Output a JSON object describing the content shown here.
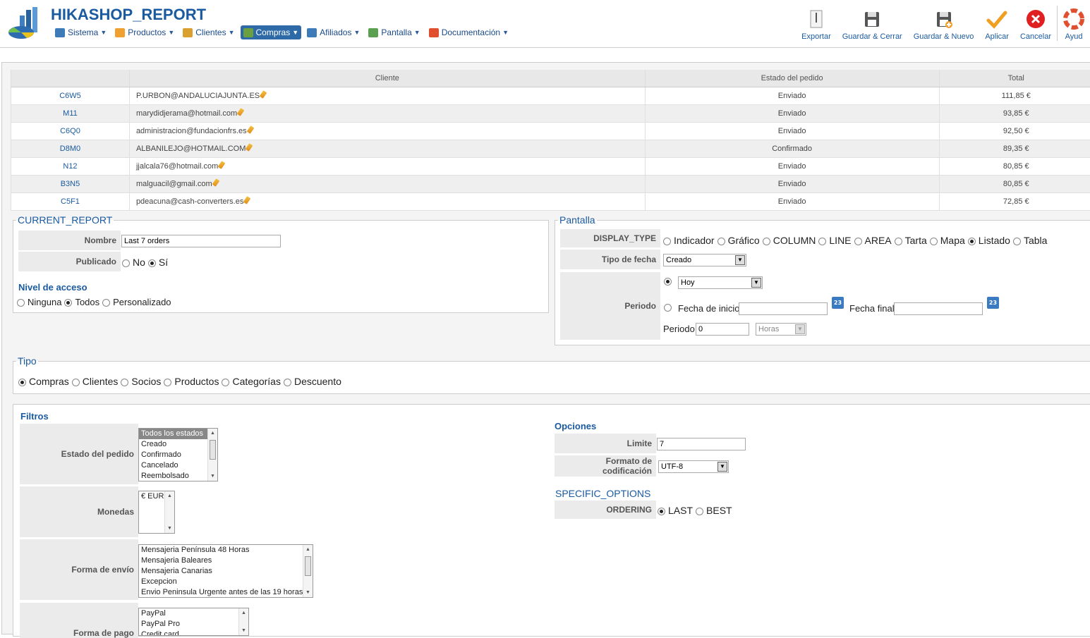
{
  "app": {
    "title": "HIKASHOP_REPORT"
  },
  "menu": [
    {
      "label": "Sistema",
      "icon": "tools-icon",
      "color": "#3c7ab8"
    },
    {
      "label": "Productos",
      "icon": "products-icon",
      "color": "#f0a030"
    },
    {
      "label": "Clientes",
      "icon": "users-icon",
      "color": "#d9a030"
    },
    {
      "label": "Compras",
      "icon": "orders-icon",
      "color": "#6aa040",
      "active": true
    },
    {
      "label": "Afiliados",
      "icon": "affiliates-icon",
      "color": "#3c7ab8"
    },
    {
      "label": "Pantalla",
      "icon": "display-icon",
      "color": "#5aa050"
    },
    {
      "label": "Documentación",
      "icon": "help-icon",
      "color": "#e05030"
    }
  ],
  "toolbar": {
    "export_label": "Exportar",
    "save_close_label": "Guardar & Cerrar",
    "save_new_label": "Guardar & Nuevo",
    "apply_label": "Aplicar",
    "cancel_label": "Cancelar",
    "help_label": "Ayud"
  },
  "orders": {
    "columns": [
      "",
      "Cliente",
      "Estado del pedido",
      "Total"
    ],
    "rows": [
      {
        "number": "C6W5",
        "client": "P.URBON@ANDALUCIAJUNTA.ES",
        "status": "Enviado",
        "total": "111,85 €"
      },
      {
        "number": "M11",
        "client": "marydidjerama@hotmail.com",
        "status": "Enviado",
        "total": "93,85 €"
      },
      {
        "number": "C6Q0",
        "client": "administracion@fundacionfrs.es",
        "status": "Enviado",
        "total": "92,50 €"
      },
      {
        "number": "D8M0",
        "client": "ALBANILEJO@HOTMAIL.COM",
        "status": "Confirmado",
        "total": "89,35 €"
      },
      {
        "number": "N12",
        "client": "jjalcala76@hotmail.com",
        "status": "Enviado",
        "total": "80,85 €"
      },
      {
        "number": "B3N5",
        "client": "malguacil@gmail.com",
        "status": "Enviado",
        "total": "80,85 €"
      },
      {
        "number": "C5F1",
        "client": "pdeacuna@cash-converters.es",
        "status": "Enviado",
        "total": "72,85 €"
      }
    ]
  },
  "current_report": {
    "legend": "CURRENT_REPORT",
    "name_label": "Nombre",
    "name_value": "Last 7 orders",
    "published_label": "Publicado",
    "published_options": [
      "No",
      "Sí"
    ],
    "published_selected": "Sí",
    "access_title": "Nivel de acceso",
    "access_options": [
      "Ninguna",
      "Todos",
      "Personalizado"
    ],
    "access_selected": "Todos"
  },
  "display": {
    "legend": "Pantalla",
    "display_type_label": "DISPLAY_TYPE",
    "display_types": [
      "Indicador",
      "Gráfico",
      "COLUMN",
      "LINE",
      "AREA",
      "Tarta",
      "Mapa",
      "Listado",
      "Tabla"
    ],
    "display_type_selected": "Listado",
    "date_type_label": "Tipo de fecha",
    "date_type_value": "Creado",
    "period_label": "Periodo",
    "period_value": "Hoy",
    "start_date_label": "Fecha de inicio",
    "end_date_label": "Fecha final",
    "calendar_day": "23",
    "period_count_label": "Periodo",
    "period_count_value": "0",
    "period_unit_value": "Horas"
  },
  "tipo": {
    "legend": "Tipo",
    "options": [
      "Compras",
      "Clientes",
      "Socios",
      "Productos",
      "Categorías",
      "Descuento"
    ],
    "selected": "Compras"
  },
  "filters": {
    "title": "Filtros",
    "order_status_label": "Estado del pedido",
    "order_status_options": [
      "Todos los estados",
      "Creado",
      "Confirmado",
      "Cancelado",
      "Reembolsado"
    ],
    "currencies_label": "Monedas",
    "currencies_options": [
      "€ EUR"
    ],
    "shipping_label": "Forma de envío",
    "shipping_options": [
      "Mensajeria Península 48 Horas",
      "Mensajeria Baleares",
      "Mensajeria Canarias",
      "Excepcion",
      "Envio Peninsula Urgente antes de las 19 horas"
    ],
    "payment_label": "Forma de pago",
    "payment_options": [
      "PayPal",
      "PayPal Pro",
      "Credit card"
    ]
  },
  "options": {
    "title": "Opciones",
    "limit_label": "Limite",
    "limit_value": "7",
    "encoding_label": "Formato de codificación",
    "encoding_value": "UTF-8",
    "specific_title": "SPECIFIC_OPTIONS",
    "ordering_label": "ORDERING",
    "ordering_options": [
      "LAST",
      "BEST"
    ],
    "ordering_selected": "LAST"
  }
}
